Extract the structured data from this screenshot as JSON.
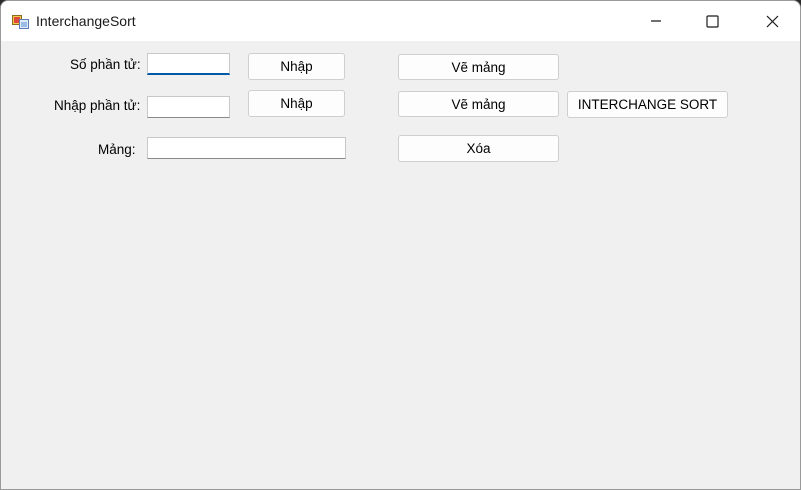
{
  "window": {
    "title": "InterchangeSort",
    "icon": "app-form-icon",
    "controls": [
      "minimize-icon",
      "maximize-icon",
      "close-icon"
    ]
  },
  "form": {
    "so_phan_tu_label": "Số phần tử:",
    "so_phan_tu_value": "",
    "nhap_phan_tu_label": "Nhập phần tử:",
    "nhap_phan_tu_value": "",
    "mang_label": "Mảng:",
    "mang_value": ""
  },
  "buttons": {
    "nhap_1": "Nhập",
    "nhap_2": "Nhập",
    "ve_mang_1": "Vẽ mảng",
    "ve_mang_2": "Vẽ mảng",
    "interchange_sort": "INTERCHANGE SORT",
    "xoa": "Xóa"
  },
  "colors": {
    "focus_underline": "#0058a8",
    "client_background": "#f0f0f0",
    "titlebar_background": "#ffffff"
  }
}
